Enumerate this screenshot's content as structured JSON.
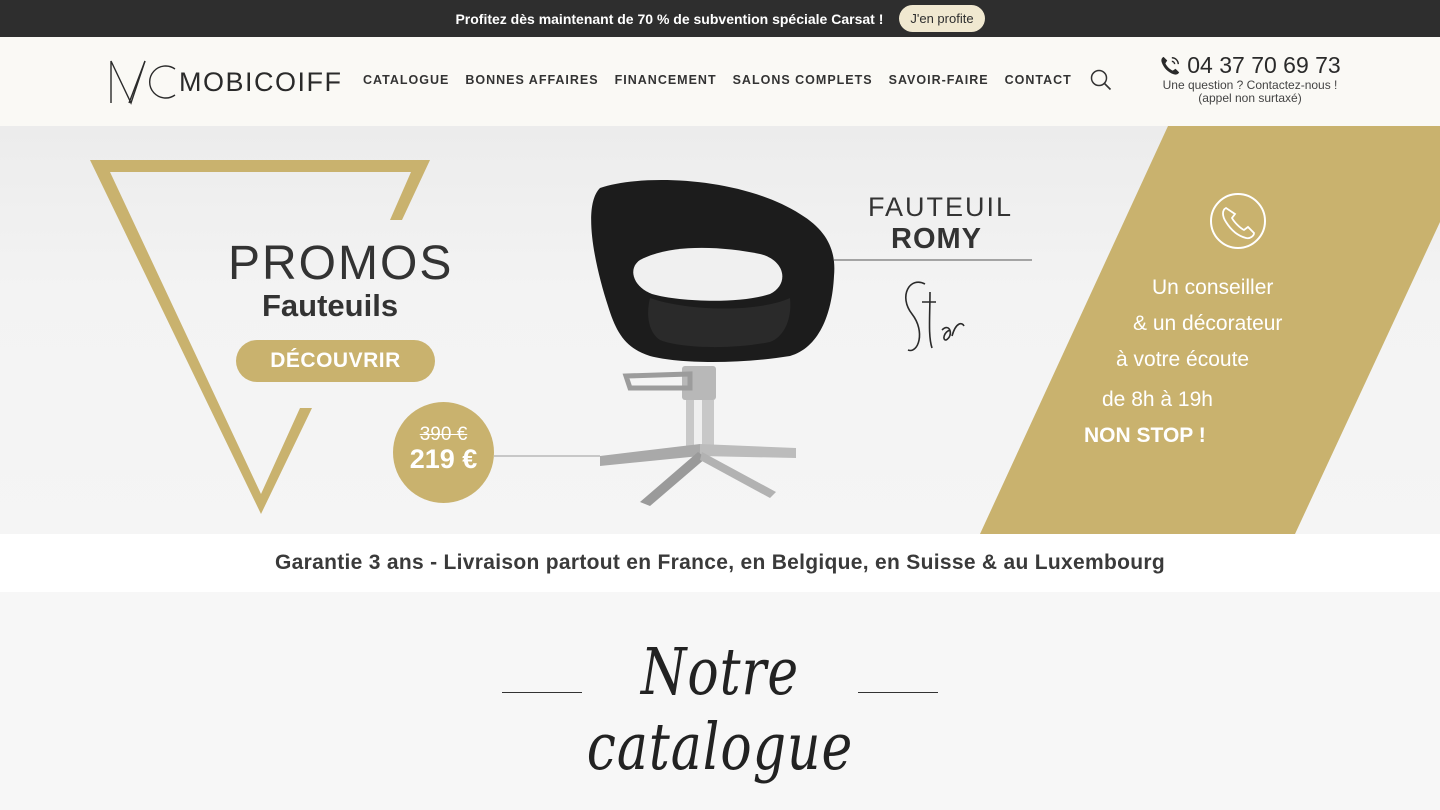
{
  "topbar": {
    "message": "Profitez dès maintenant de 70 % de subvention spéciale Carsat !",
    "cta_label": "J'en profite"
  },
  "header": {
    "logo_text": "MOBICOIFF",
    "nav_items": [
      "CATALOGUE",
      "BONNES AFFAIRES",
      "FINANCEMENT",
      "SALONS COMPLETS",
      "SAVOIR-FAIRE",
      "CONTACT"
    ],
    "phone": "04 37 70 69 73",
    "contact_line1": "Une question ? Contactez-nous !",
    "contact_line2": "(appel non surtaxé)"
  },
  "hero": {
    "promo_title": "PROMOS",
    "promo_subtitle": "Fauteuils",
    "discover_label": "DÉCOUVRIR",
    "price_old": "390 €",
    "price_new": "219 €",
    "chair_label": "FAUTEUIL",
    "chair_name": "ROMY",
    "signature": "Star",
    "advisor_lines": [
      "Un conseiller",
      "& un décorateur",
      "à votre écoute",
      "de 8h à 19h"
    ],
    "advisor_emphasis": "NON STOP !"
  },
  "guarantee": {
    "text": "Garantie 3 ans - Livraison partout en France, en Belgique, en Suisse & au Luxembourg"
  },
  "catalogue": {
    "heading": "Notre catalogue"
  },
  "colors": {
    "gold": "#c9b26e",
    "dark": "#2e2e2e",
    "cream": "#faf9f5"
  }
}
